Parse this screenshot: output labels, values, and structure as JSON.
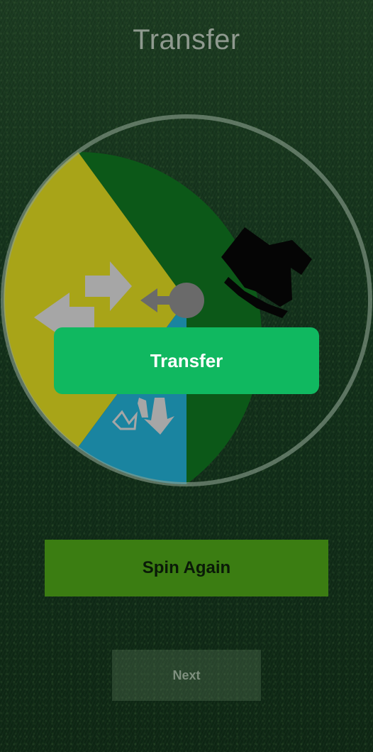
{
  "header": {
    "title": "Transfer"
  },
  "wheel": {
    "segments": [
      {
        "name": "transfer",
        "color": "#a8a418",
        "icon": "transfer-arrows-icon"
      },
      {
        "name": "jersey",
        "color": "#0c5818",
        "icon": "jersey-icon"
      },
      {
        "name": "swap-down",
        "color": "#1a84a0",
        "icon": "swap-down-icon"
      }
    ],
    "pointer_icon": "pointer-knob-icon",
    "result_label": "Transfer"
  },
  "actions": {
    "spin_label": "Spin Again",
    "next_label": "Next"
  },
  "colors": {
    "result_banner": "#10b860",
    "spin_button": "#3b7d12",
    "rim": "#8ea291"
  }
}
